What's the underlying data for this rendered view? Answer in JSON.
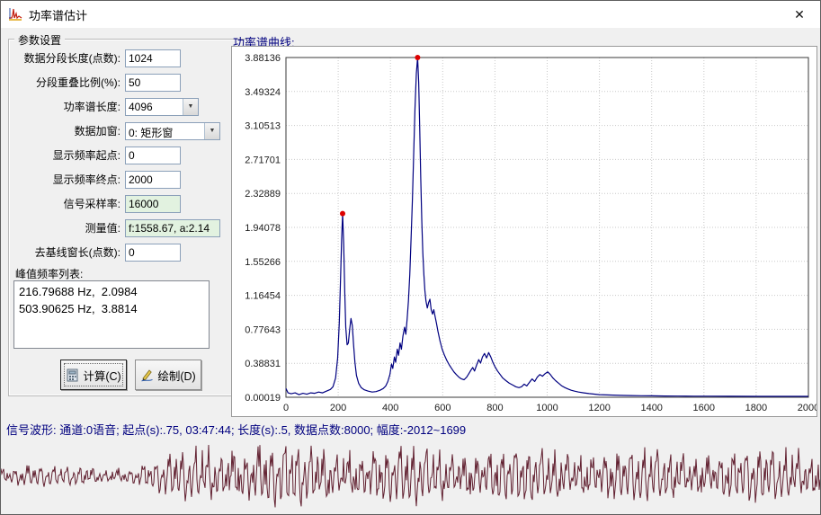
{
  "window": {
    "title": "功率谱估计"
  },
  "icons": {
    "app": "spectrum-icon",
    "close": "✕",
    "combo_arrow": "▼",
    "calculate": "calculator-icon",
    "draw": "pencil-icon"
  },
  "params": {
    "group_title": "参数设置",
    "fields": [
      {
        "name": "segment-length-input",
        "label": "数据分段长度(点数):",
        "value": "1024",
        "type": "input"
      },
      {
        "name": "overlap-ratio-input",
        "label": "分段重叠比例(%):",
        "value": "50",
        "type": "input"
      },
      {
        "name": "spectrum-length-select",
        "label": "功率谱长度:",
        "value": "4096",
        "type": "select"
      },
      {
        "name": "window-type-select",
        "label": "数据加窗:",
        "value": "0: 矩形窗",
        "type": "select",
        "wide": true
      },
      {
        "name": "freq-start-input",
        "label": "显示频率起点:",
        "value": "0",
        "type": "input"
      },
      {
        "name": "freq-end-input",
        "label": "显示频率终点:",
        "value": "2000",
        "type": "input"
      },
      {
        "name": "sample-rate-input",
        "label": "信号采样率:",
        "value": "16000",
        "type": "input",
        "highlight": true
      },
      {
        "name": "measured-value-input",
        "label": "测量值:",
        "value": "f:1558.67, a:2.14",
        "type": "input",
        "highlight": true,
        "wide": true
      },
      {
        "name": "baseline-window-input",
        "label": "去基线窗长(点数):",
        "value": "0",
        "type": "input"
      }
    ],
    "peak_list_label": "峰值频率列表:",
    "peaks": [
      "216.79688 Hz,  2.0984",
      "503.90625 Hz,  3.8814"
    ],
    "buttons": [
      {
        "label": "计算(C)"
      },
      {
        "label": "绘制(D)"
      }
    ]
  },
  "chart_data": {
    "type": "line",
    "title": "功率谱曲线:",
    "xlabel": "",
    "ylabel": "",
    "xlim": [
      0,
      2000
    ],
    "ylim": [
      0.00019,
      3.88136
    ],
    "xticks": [
      0,
      200,
      400,
      600,
      800,
      1000,
      1200,
      1400,
      1600,
      1800,
      2000
    ],
    "yticks": [
      0.00019,
      0.38831,
      0.77643,
      1.16454,
      1.55266,
      1.94078,
      2.32889,
      2.71701,
      3.10513,
      3.49324,
      3.88136
    ],
    "ytick_labels": [
      "0.00019",
      "0.38831",
      "0.77643",
      "1.16454",
      "1.55266",
      "1.94078",
      "2.32889",
      "2.71701",
      "3.10513",
      "3.49324",
      "3.88136"
    ],
    "grid": true,
    "legend": false,
    "line_color": "#000080",
    "marker_color": "#dd0000",
    "markers": [
      [
        216.79688,
        2.0984
      ],
      [
        503.90625,
        3.8814
      ]
    ],
    "points": [
      [
        0,
        0.1
      ],
      [
        8,
        0.05
      ],
      [
        20,
        0.04
      ],
      [
        35,
        0.05
      ],
      [
        50,
        0.03
      ],
      [
        65,
        0.045
      ],
      [
        80,
        0.035
      ],
      [
        95,
        0.05
      ],
      [
        110,
        0.045
      ],
      [
        125,
        0.06
      ],
      [
        140,
        0.05
      ],
      [
        155,
        0.07
      ],
      [
        170,
        0.09
      ],
      [
        180,
        0.12
      ],
      [
        190,
        0.22
      ],
      [
        198,
        0.45
      ],
      [
        204,
        0.85
      ],
      [
        209,
        1.35
      ],
      [
        213,
        1.8
      ],
      [
        216.8,
        2.0984
      ],
      [
        221,
        1.75
      ],
      [
        225,
        1.2
      ],
      [
        229,
        0.8
      ],
      [
        234,
        0.6
      ],
      [
        239,
        0.62
      ],
      [
        244,
        0.78
      ],
      [
        249,
        0.9
      ],
      [
        254,
        0.82
      ],
      [
        259,
        0.6
      ],
      [
        264,
        0.4
      ],
      [
        270,
        0.25
      ],
      [
        278,
        0.16
      ],
      [
        288,
        0.11
      ],
      [
        300,
        0.085
      ],
      [
        315,
        0.07
      ],
      [
        330,
        0.06
      ],
      [
        345,
        0.065
      ],
      [
        360,
        0.08
      ],
      [
        372,
        0.1
      ],
      [
        382,
        0.13
      ],
      [
        390,
        0.18
      ],
      [
        398,
        0.26
      ],
      [
        404,
        0.38
      ],
      [
        409,
        0.33
      ],
      [
        415,
        0.46
      ],
      [
        420,
        0.4
      ],
      [
        426,
        0.55
      ],
      [
        431,
        0.48
      ],
      [
        437,
        0.62
      ],
      [
        442,
        0.55
      ],
      [
        448,
        0.7
      ],
      [
        454,
        0.8
      ],
      [
        459,
        0.72
      ],
      [
        464,
        0.9
      ],
      [
        469,
        1.1
      ],
      [
        474,
        1.4
      ],
      [
        479,
        1.8
      ],
      [
        484,
        2.25
      ],
      [
        489,
        2.8
      ],
      [
        494,
        3.3
      ],
      [
        499,
        3.7
      ],
      [
        503.9,
        3.8814
      ],
      [
        508,
        3.6
      ],
      [
        512,
        3.1
      ],
      [
        516,
        2.5
      ],
      [
        520,
        2.0
      ],
      [
        524,
        1.65
      ],
      [
        528,
        1.4
      ],
      [
        532,
        1.22
      ],
      [
        536,
        1.1
      ],
      [
        541,
        1.02
      ],
      [
        546,
        1.08
      ],
      [
        551,
        1.12
      ],
      [
        556,
        1.0
      ],
      [
        561,
        0.95
      ],
      [
        566,
        1.0
      ],
      [
        571,
        0.92
      ],
      [
        576,
        0.85
      ],
      [
        582,
        0.75
      ],
      [
        590,
        0.64
      ],
      [
        598,
        0.55
      ],
      [
        607,
        0.48
      ],
      [
        616,
        0.42
      ],
      [
        625,
        0.37
      ],
      [
        634,
        0.33
      ],
      [
        643,
        0.29
      ],
      [
        652,
        0.26
      ],
      [
        662,
        0.23
      ],
      [
        672,
        0.21
      ],
      [
        682,
        0.2
      ],
      [
        692,
        0.23
      ],
      [
        700,
        0.27
      ],
      [
        708,
        0.31
      ],
      [
        715,
        0.34
      ],
      [
        722,
        0.3
      ],
      [
        730,
        0.37
      ],
      [
        738,
        0.43
      ],
      [
        745,
        0.39
      ],
      [
        752,
        0.46
      ],
      [
        760,
        0.5
      ],
      [
        768,
        0.45
      ],
      [
        776,
        0.51
      ],
      [
        784,
        0.46
      ],
      [
        792,
        0.4
      ],
      [
        800,
        0.35
      ],
      [
        810,
        0.3
      ],
      [
        820,
        0.26
      ],
      [
        830,
        0.22
      ],
      [
        842,
        0.19
      ],
      [
        855,
        0.16
      ],
      [
        868,
        0.14
      ],
      [
        880,
        0.12
      ],
      [
        892,
        0.11
      ],
      [
        902,
        0.12
      ],
      [
        912,
        0.15
      ],
      [
        922,
        0.13
      ],
      [
        932,
        0.17
      ],
      [
        942,
        0.21
      ],
      [
        952,
        0.18
      ],
      [
        962,
        0.23
      ],
      [
        972,
        0.26
      ],
      [
        982,
        0.24
      ],
      [
        992,
        0.27
      ],
      [
        1002,
        0.29
      ],
      [
        1012,
        0.26
      ],
      [
        1022,
        0.22
      ],
      [
        1032,
        0.19
      ],
      [
        1044,
        0.16
      ],
      [
        1056,
        0.13
      ],
      [
        1068,
        0.11
      ],
      [
        1080,
        0.095
      ],
      [
        1092,
        0.08
      ],
      [
        1105,
        0.07
      ],
      [
        1120,
        0.06
      ],
      [
        1140,
        0.05
      ],
      [
        1160,
        0.042
      ],
      [
        1180,
        0.036
      ],
      [
        1200,
        0.03
      ],
      [
        1240,
        0.026
      ],
      [
        1280,
        0.022
      ],
      [
        1320,
        0.02
      ],
      [
        1360,
        0.018
      ],
      [
        1400,
        0.017
      ],
      [
        1450,
        0.015
      ],
      [
        1500,
        0.014
      ],
      [
        1560,
        0.013
      ],
      [
        1620,
        0.012
      ],
      [
        1700,
        0.011
      ],
      [
        1800,
        0.01
      ],
      [
        1900,
        0.01
      ],
      [
        2000,
        0.01
      ]
    ]
  },
  "status": {
    "text": "信号波形: 通道:0语音; 起点(s):.75, 03:47:44; 长度(s):.5, 数据点数:8000; 幅度:-2012~1699"
  },
  "waveform": {
    "color": "#612030",
    "envelope": [
      [
        0,
        0.3
      ],
      [
        0.04,
        0.36
      ],
      [
        0.07,
        0.27
      ],
      [
        0.1,
        0.32
      ],
      [
        0.13,
        0.25
      ],
      [
        0.16,
        0.3
      ],
      [
        0.18,
        0.42
      ],
      [
        0.21,
        0.68
      ],
      [
        0.24,
        0.88
      ],
      [
        0.28,
        0.98
      ],
      [
        0.32,
        1.0
      ],
      [
        0.36,
        0.95
      ],
      [
        0.4,
        0.9
      ],
      [
        0.45,
        0.86
      ],
      [
        0.5,
        0.9
      ],
      [
        0.55,
        0.84
      ],
      [
        0.6,
        0.87
      ],
      [
        0.65,
        0.82
      ],
      [
        0.7,
        0.85
      ],
      [
        0.75,
        0.8
      ],
      [
        0.8,
        0.82
      ],
      [
        0.85,
        0.78
      ],
      [
        0.9,
        0.82
      ],
      [
        0.95,
        0.84
      ],
      [
        1,
        0.86
      ]
    ],
    "components": [
      [
        128,
        0.5,
        0
      ],
      [
        64,
        0.28,
        1.1
      ],
      [
        256,
        0.3,
        2.3
      ],
      [
        384,
        0.18,
        0.6
      ],
      [
        792,
        0.2,
        0.2
      ],
      [
        29,
        0.12,
        0.9
      ],
      [
        501,
        0.15,
        2.0
      ]
    ]
  }
}
